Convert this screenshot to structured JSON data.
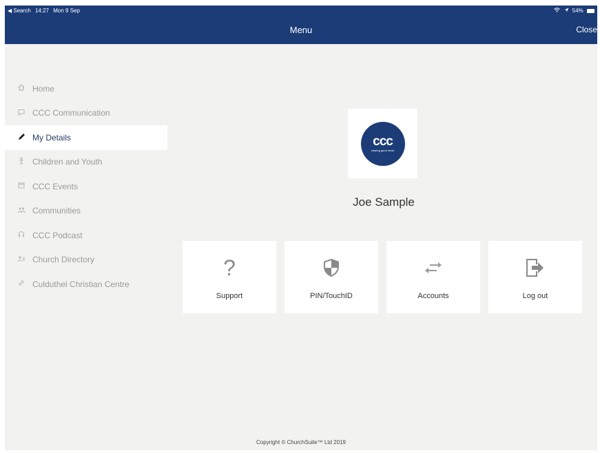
{
  "status_bar": {
    "back": "◀ Search",
    "time": "14:27",
    "date": "Mon 9 Sep",
    "battery": "54%"
  },
  "navbar": {
    "title": "Menu",
    "close_label": "Close"
  },
  "sidebar": {
    "items": [
      {
        "label": "Home",
        "icon": "home-icon"
      },
      {
        "label": "CCC Communication",
        "icon": "speech-bubble-icon"
      },
      {
        "label": "My Details",
        "icon": "pencil-icon",
        "active": true
      },
      {
        "label": "Children and Youth",
        "icon": "child-icon"
      },
      {
        "label": "CCC Events",
        "icon": "calendar-icon"
      },
      {
        "label": "Communities",
        "icon": "people-icon"
      },
      {
        "label": "CCC Podcast",
        "icon": "headphones-icon"
      },
      {
        "label": "Church Directory",
        "icon": "directory-icon"
      },
      {
        "label": "Culduthel Christian Centre",
        "icon": "link-icon"
      }
    ]
  },
  "profile": {
    "logo_text": "ccc",
    "logo_tagline": "sharing good news",
    "name": "Joe Sample"
  },
  "actions": [
    {
      "label": "Support",
      "icon": "question-icon"
    },
    {
      "label": "PIN/TouchID",
      "icon": "shield-icon"
    },
    {
      "label": "Accounts",
      "icon": "swap-arrows-icon"
    },
    {
      "label": "Log out",
      "icon": "logout-icon"
    }
  ],
  "footer": {
    "copyright": "Copyright © ChurchSuite™ Ltd 2019"
  },
  "colors": {
    "brand": "#1c3c78",
    "background": "#f2f2f0",
    "tile": "#ffffff"
  }
}
